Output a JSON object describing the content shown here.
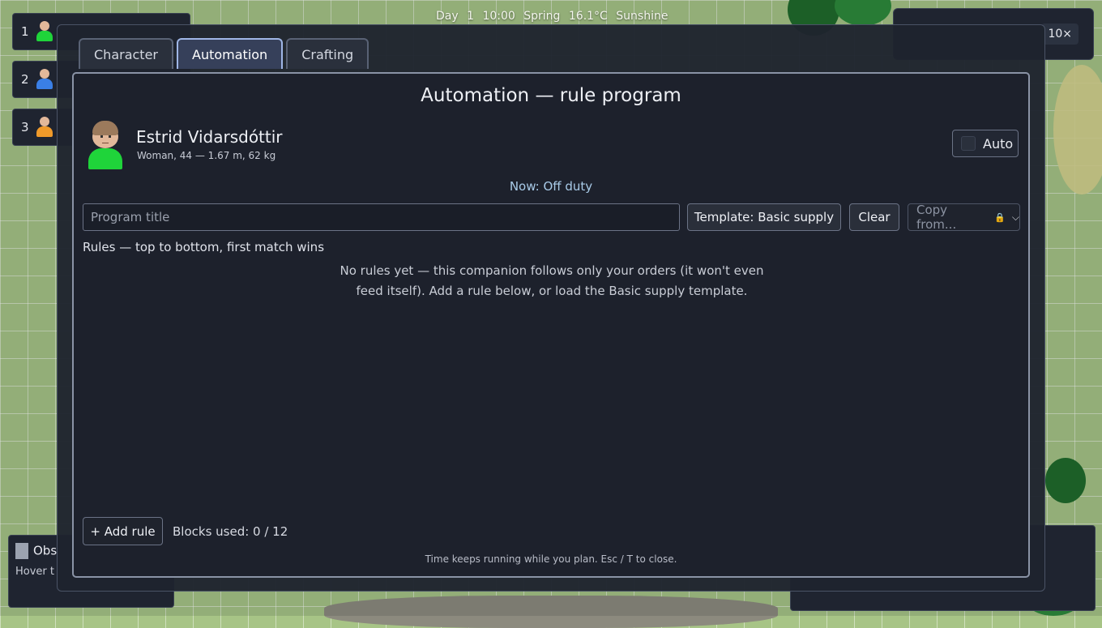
{
  "hud": {
    "status": "Day 1  10:00  Spring  16.1°C  Sunshine",
    "speed_label": "10×",
    "observe_title": "Obs",
    "observe_hint": "Hover t"
  },
  "roster": [
    {
      "num": "1",
      "color": "#1fd43a"
    },
    {
      "num": "2",
      "color": "#3a7fe6"
    },
    {
      "num": "3",
      "color": "#f09a2a"
    }
  ],
  "tabs": [
    {
      "label": "Character"
    },
    {
      "label": "Automation"
    },
    {
      "label": "Crafting"
    }
  ],
  "panel": {
    "title": "Automation — rule program",
    "character": {
      "name": "Estrid Vidarsdóttir",
      "details": "Woman, 44 — 1.67 m, 62 kg"
    },
    "auto_label": "Auto",
    "status": "Now: Off duty",
    "program_title_placeholder": "Program title",
    "template_button": "Template: Basic supply",
    "clear_button": "Clear",
    "copy_from": "Copy from...",
    "rules_label": "Rules — top to bottom, first match wins",
    "empty_message": "No rules yet — this companion follows only your orders (it won't even feed itself). Add a rule below, or load the Basic supply template.",
    "add_rule_button": "+ Add rule",
    "blocks_used": "Blocks used: 0 / 12",
    "footer": "Time keeps running while you plan.   Esc / T to close."
  },
  "colors": {
    "active_tab_border": "#9fb6e6",
    "status_text": "#a9cbe8",
    "avatar_body": "#1fd43a"
  }
}
